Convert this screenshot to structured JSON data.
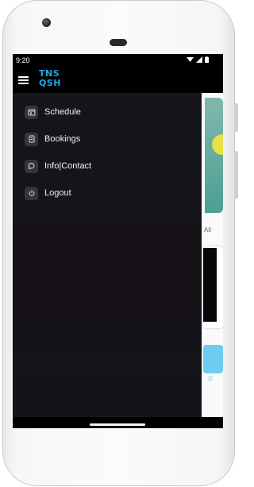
{
  "status_bar": {
    "time": "9:20"
  },
  "app_bar": {
    "logo_line1": "TNS",
    "logo_line2": "QSH",
    "brand_color": "#1fa8e6"
  },
  "drawer": {
    "items": [
      {
        "label": "Schedule",
        "icon": "calendar-icon"
      },
      {
        "label": "Bookings",
        "icon": "list-icon"
      },
      {
        "label": "Info|Contact",
        "icon": "chat-icon"
      },
      {
        "label": "Logout",
        "icon": "power-icon"
      }
    ]
  },
  "background": {
    "filter_label": "All"
  }
}
